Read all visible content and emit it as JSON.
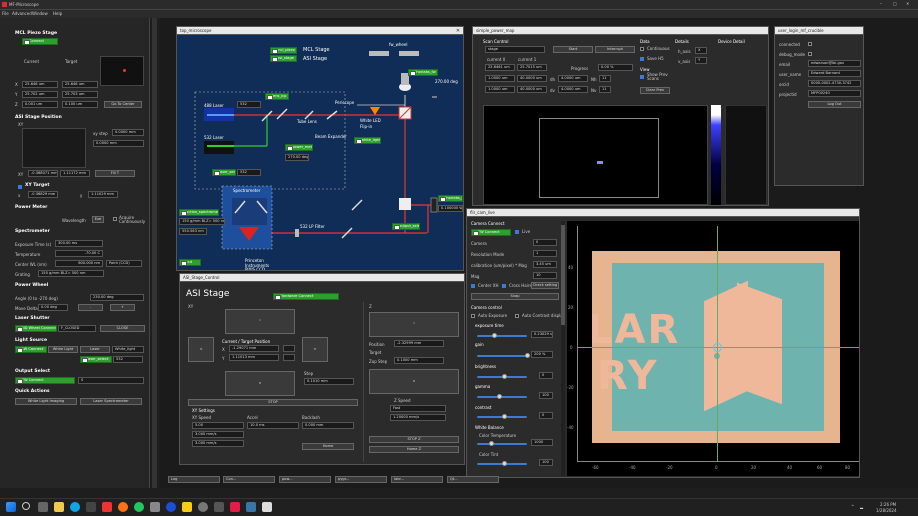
{
  "app": {
    "title": "MF-Microscope",
    "menu": [
      "File",
      "Advanced",
      "Window",
      "Help"
    ]
  },
  "left": {
    "piezo": {
      "title": "MCL Piezo Stage",
      "connect": "Connect",
      "current": "Current",
      "target": "Target",
      "x": "X",
      "y": "Y",
      "z": "Z",
      "xc": "25.646 um",
      "xt": "25.646 um",
      "yc": "25.702 um",
      "yt": "25.703 um",
      "zc": "0.001 um",
      "zt": "0.100 um",
      "center": "Go To Center"
    },
    "asi": {
      "title": "ASI Stage Position",
      "xy": "XY",
      "xystep_l": "xy step",
      "xystep": "0.0000 mm",
      "z": "Z",
      "zstep": "0.0000 mm",
      "xy_l": "XY",
      "xy1": "-0.368071 mm",
      "xy2": "1.11172 mm",
      "fill": "Fill T",
      "zl": "Z",
      "zval": "0.0000 mm"
    },
    "xy_target": {
      "title": "XY Target",
      "x": "x",
      "xv": "-0.36829 mm",
      "y": "y",
      "yv": "1.11029 mm"
    },
    "power": {
      "title": "Power Meter",
      "wavelength": "Wavelength",
      "wv": "Exe",
      "auto": "Acquire Continuously"
    },
    "spec": {
      "title": "Spectrometer",
      "exp": "Exposure Time (s)",
      "expv": "300.00 ms",
      "temp": "Temperature",
      "tempv": "-70.00 C",
      "cwl": "Center WL (nm)",
      "cwlv": "600.000 nm",
      "cwl2": "Point (CCD)",
      "grating": "Grating",
      "gratingv": "150 g/mm BLZ= 500 nm"
    },
    "wheel": {
      "title": "Power Wheel",
      "angle": "Angle (0 to -270 deg)",
      "anglev": "230.00 deg",
      "move": "Move Delta",
      "movev": "0.00 deg",
      "minus": "-",
      "plus": "+"
    },
    "shutter": {
      "title": "Laser Shutter",
      "btn": "ND Wheel Connect",
      "sel": "F_CLOSED",
      "close": "CLOSE"
    },
    "light": {
      "title": "Light Source",
      "btn": "LW Connect",
      "wl": "White Light",
      "laser": "Laser",
      "wlr": "White_light",
      "laser_sel": "laser_select",
      "laser_v": "532"
    },
    "output": {
      "title": "Output Select",
      "btn": "FW Connect",
      "v": "S"
    },
    "quick": {
      "title": "Quick Actions",
      "b1": "White Light Imaging",
      "b2": "Laser Spectrometer"
    }
  },
  "micro": {
    "title": "top_microscope",
    "mcl": "MCL Stage",
    "asi": "ASI Stage",
    "mcl_ls": "mcl_piezo",
    "asi_ls": "asi_stage",
    "fw": "fw_wheel",
    "laser488": "488 Laser",
    "laser532": "532 Laser",
    "lsel": "laser_select",
    "lselv": "532",
    "mirr": "mirror",
    "per": "Periscope",
    "wled": "White LED",
    "flip": "Flip-in",
    "lsel2": "white_light_fli",
    "beam": "Beam Expander",
    "tube": "Tube Lens",
    "spec": "Spectrometer",
    "spec2": "Princeton Instruments PIXIS CCD",
    "filter": "532 LP Filter",
    "grat": "grating",
    "ccd": "ccd",
    "fiber_sel": "action_spectrometer",
    "gratv": "150 g/mm BLZ= 500 nm",
    "cwl": "550.563 nm",
    "pm": "thorlabs_pm",
    "pm_v": "0.100000 W",
    "out_sel": "output_select",
    "ph": "power_meter",
    "lens": "lens_lcp",
    "pos": "270.00 deg",
    "tdbtn": "thorlabs_fw"
  },
  "asi_win": {
    "title": "ASI_Stage_Control",
    "h": "ASI Stage",
    "conn": "Hardware Connect",
    "xy": "XY",
    "cur": "Current / Target Position",
    "x": "X",
    "xv": "-1.29071 mm",
    "y": "Y",
    "yv": "1.11013 mm",
    "step": "Step",
    "stepv": "0.1010 mm",
    "stop": "STOP",
    "z": "Z",
    "zpos": "Position",
    "zposv": "-2.32999 mm",
    "ztgt": "Target",
    "zstep": "Zop Step",
    "zstepv": "0.1000 mm",
    "zspeed": "Z Speed",
    "zsp1": "Fast",
    "zsp2": "1.20000 mm/s",
    "zstop": "STOP Z",
    "zhome": "Home Z",
    "xysettings": "XY Settings",
    "xyspeed": "XY Speed",
    "accel": "Accel",
    "backlash": "Backlash",
    "sp1": "5.00",
    "sp2": "10.0 ms",
    "sp3": "0.000 mm",
    "v1": "3.000 mm/s",
    "v2": "3.000 mm/s",
    "home": "Home"
  },
  "scan": {
    "title": "simple_power_map",
    "ctrl": "Scan Control",
    "mode": "stage",
    "start": "Start",
    "interrupt": "Interrupt",
    "data": "Data",
    "cont": "Continuous",
    "save": "Save H5",
    "view": "View",
    "show": "Show Prev Scans",
    "clear": "Clear Prev",
    "details": "Details",
    "xaxis": "h_axis",
    "yaxis": "v_axis",
    "devd": "Device Detail",
    "cur0": "current 0",
    "cur1": "current 1",
    "h0": "25.6461 um",
    "h1": "25.7015 um",
    "prog": "Progress",
    "progv": "0.00 %",
    "s0": "1.0000 um",
    "s1": "1.0000 um",
    "s2": "4.0000 um",
    "s3": "4.0000 um",
    "n0": "11",
    "n1": "11",
    "e0": "40.0000 um",
    "e1": "40.0000 um",
    "c0": "0.0000 um",
    "c1": "0.0000 um",
    "ax0": "X",
    "ax1": "Y",
    "dh": "dh",
    "dv": "dv",
    "nh": "Nh",
    "nv": "Nv"
  },
  "login": {
    "title": "user_login_mf_crucible",
    "f": [
      [
        "connected",
        ""
      ],
      [
        "debug_mode",
        ""
      ],
      [
        "email",
        "edwarson@lbl.gov"
      ],
      [
        "user_name",
        "Edward Barnard"
      ],
      [
        "orcid",
        "0000-0002-4730-3742"
      ],
      [
        "projectid",
        "MFP00240"
      ]
    ],
    "btn": "Log Out"
  },
  "cam": {
    "title": "flir_cam_live",
    "ctrl": "Camera Connect",
    "conn": "FW Connect",
    "live": "Live",
    "cam": "Camera",
    "camv": "0",
    "res": "Resolution Mode",
    "resv": "1",
    "calib": "calibration (um/pixel) * Mag",
    "calibv": "3.45 um",
    "mag": "Mag",
    "magv": "10",
    "crh": "Center XH",
    "crh2": "Cross Hairs",
    "check": "Check setting",
    "snap": "Snap",
    "ctrl2": "Camera control",
    "autoexp": "Auto Exposure",
    "autodisp": "Auto Contrast display",
    "exp": "exposure time",
    "expv": "0.23029 s",
    "gain": "gain",
    "gainv": "200 %",
    "bright": "brightness",
    "brightv": "0",
    "gamma": "gamma",
    "gammav": "100",
    "contrast": "contrast",
    "contrastv": "0",
    "wb": "White Balance",
    "ct": "Color Temperature",
    "ctv": "1000",
    "tint": "Color Tint",
    "tintv": "100",
    "ticks_x": [
      "-60",
      "-40",
      "-20",
      "0",
      "20",
      "40",
      "60",
      "80"
    ],
    "ticks_y": [
      "40",
      "20",
      "0",
      "-20",
      "-40"
    ],
    "img_text1": "LAR",
    "img_text2": "RY"
  },
  "taskbar": {
    "time": "2:26 PM",
    "date": "1/28/2024",
    "tabs": [
      "Log",
      "Con...",
      "pow...",
      "pygr...",
      "labr...",
      "Qt..."
    ]
  },
  "colors": {
    "panel": "#2b2b2b",
    "green": "#2e9e2e",
    "scheme_bg": "#0f2d57"
  }
}
